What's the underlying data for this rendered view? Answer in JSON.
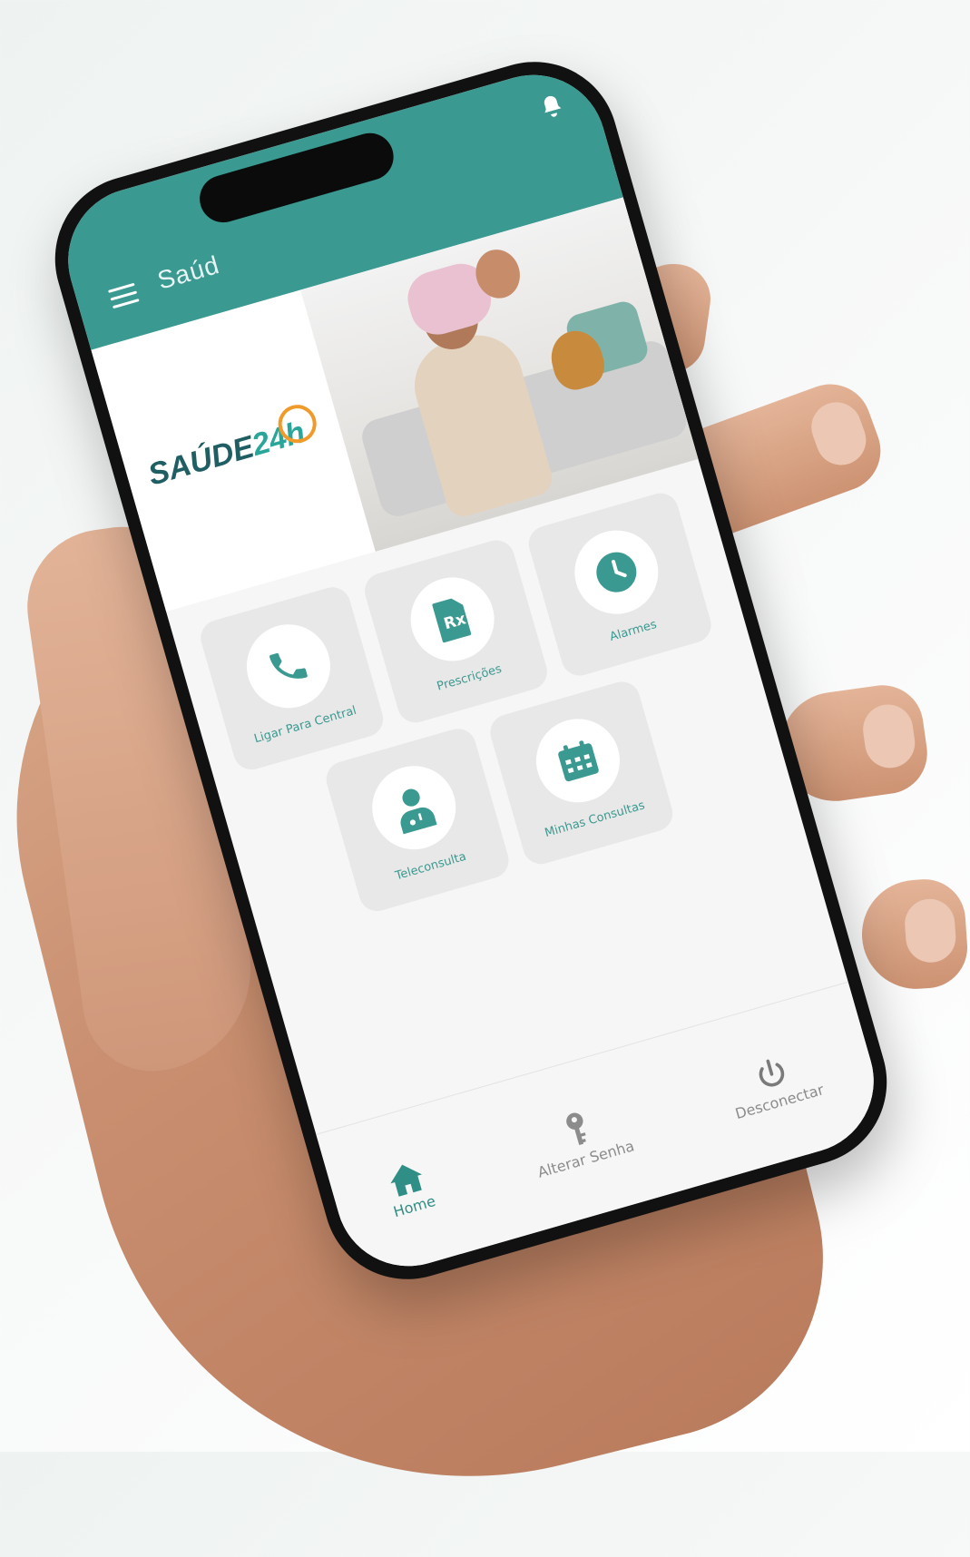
{
  "app": {
    "title": "Saúd"
  },
  "banner": {
    "logo_part1": "SAÚDE",
    "logo_part2": "24h"
  },
  "tiles": [
    {
      "label": "Ligar Para Central",
      "icon": "phone-icon"
    },
    {
      "label": "Prescrições",
      "icon": "prescription-icon"
    },
    {
      "label": "Alarmes",
      "icon": "clock-icon"
    },
    {
      "label": "Teleconsulta",
      "icon": "doctor-icon"
    },
    {
      "label": "Minhas Consultas",
      "icon": "calendar-icon"
    }
  ],
  "nav": {
    "home": "Home",
    "change_password": "Alterar Senha",
    "logout": "Desconectar"
  },
  "colors": {
    "primary": "#3a9990",
    "tile_bg": "#e8e8e8",
    "logo_dark": "#1f5f63",
    "logo_orange": "#f09a2a"
  }
}
